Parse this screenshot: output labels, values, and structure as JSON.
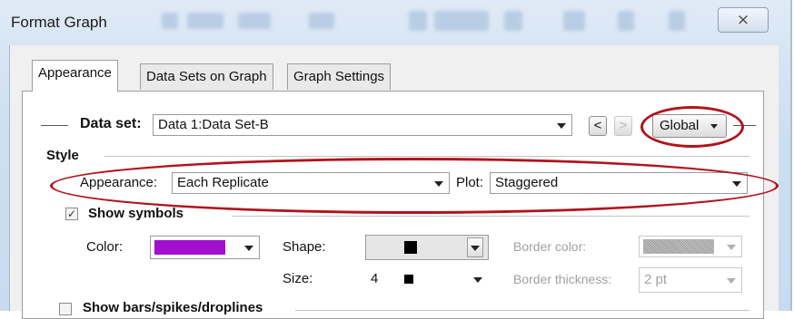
{
  "window": {
    "title": "Format Graph",
    "close_glyph": "⨯"
  },
  "tabs": [
    {
      "label": "Appearance",
      "active": true
    },
    {
      "label": "Data Sets on Graph",
      "active": false
    },
    {
      "label": "Graph Settings",
      "active": false
    }
  ],
  "dataset": {
    "label": "Data set:",
    "value": "Data 1:Data Set-B",
    "prev": "<",
    "next": ">",
    "global_label": "Global"
  },
  "style": {
    "section_label": "Style",
    "appearance_label": "Appearance:",
    "appearance_value": "Each Replicate",
    "plot_label": "Plot:",
    "plot_value": "Staggered"
  },
  "symbols": {
    "checkbox_label": "Show symbols",
    "checked": true,
    "check_glyph": "✓",
    "color_label": "Color:",
    "color_value": "#a20fcf",
    "shape_label": "Shape:",
    "size_label": "Size:",
    "size_value": "4",
    "border_color_label": "Border color:",
    "border_thickness_label": "Border thickness:",
    "border_thickness_value": "2 pt"
  },
  "bars": {
    "checkbox_label": "Show bars/spikes/droplines",
    "checked": false
  },
  "accent_color": "#b0141c"
}
